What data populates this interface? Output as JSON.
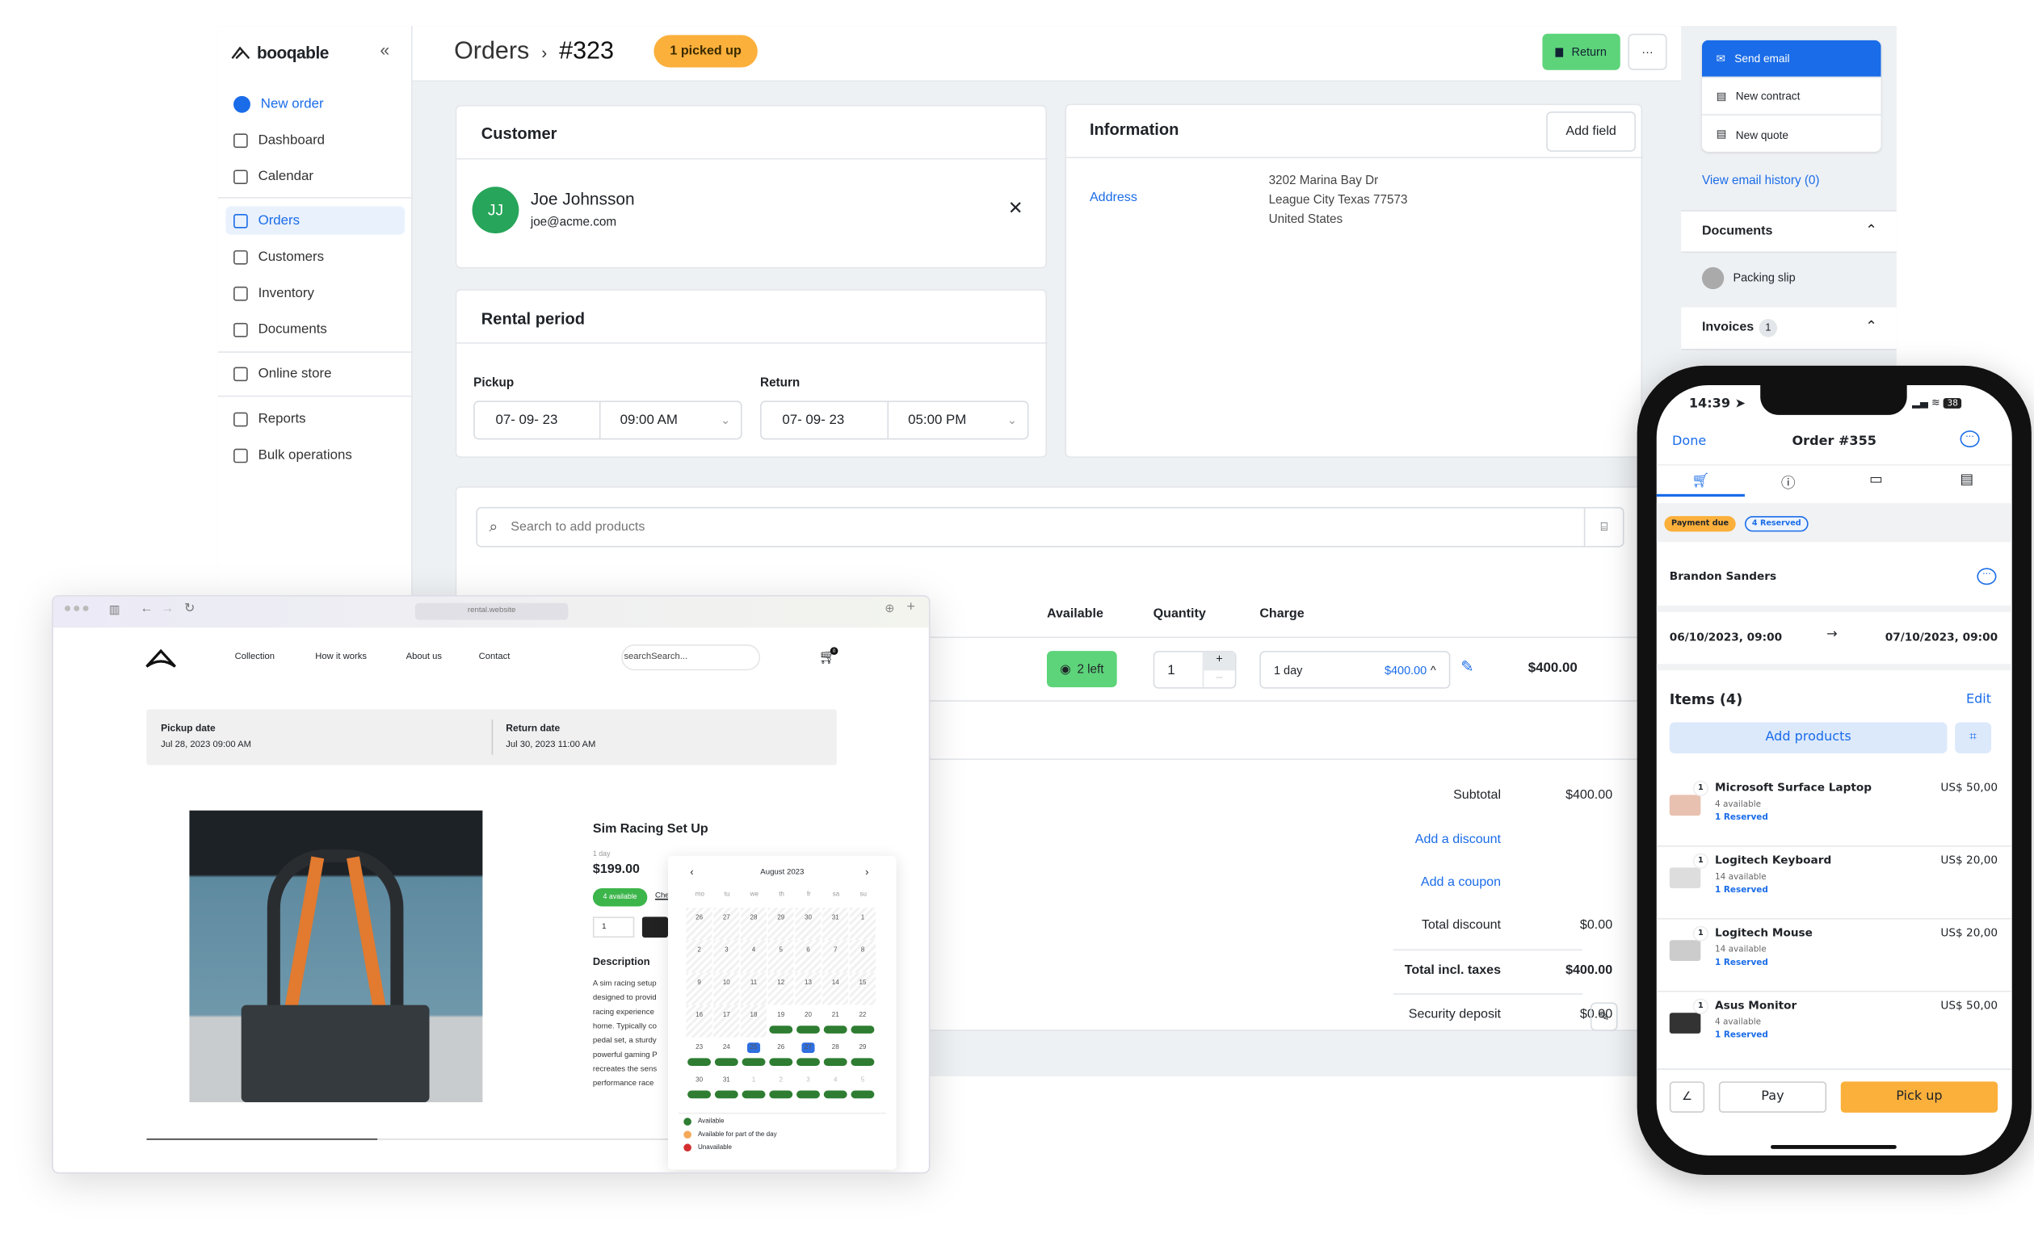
{
  "brand": {
    "name": "booqable"
  },
  "sidebar": {
    "items": [
      {
        "label": "New order",
        "icon": "plus-circle-icon"
      },
      {
        "label": "Dashboard",
        "icon": "gauge-icon"
      },
      {
        "label": "Calendar",
        "icon": "calendar-icon"
      },
      {
        "label": "Orders",
        "icon": "inbox-icon",
        "active": true
      },
      {
        "label": "Customers",
        "icon": "user-icon"
      },
      {
        "label": "Inventory",
        "icon": "box-icon"
      },
      {
        "label": "Documents",
        "icon": "document-icon"
      },
      {
        "label": "Online store",
        "icon": "store-icon"
      },
      {
        "label": "Reports",
        "icon": "chart-icon"
      },
      {
        "label": "Bulk operations",
        "icon": "stack-icon"
      }
    ]
  },
  "header": {
    "breadcrumb": "Orders",
    "separator": "›",
    "order_number": "#323",
    "status_badge": "1 picked up",
    "return_label": "Return",
    "more_label": "···"
  },
  "customer": {
    "title": "Customer",
    "initials": "JJ",
    "name": "Joe Johnsson",
    "email": "joe@acme.com"
  },
  "rental_period": {
    "title": "Rental period",
    "pickup_label": "Pickup",
    "pickup_date": "07- 09- 23",
    "pickup_time": "09:00 AM",
    "return_label": "Return",
    "return_date": "07- 09- 23",
    "return_time": "05:00 PM"
  },
  "information": {
    "title": "Information",
    "add_field": "Add field",
    "address_label": "Address",
    "address_lines": [
      "3202 Marina Bay Dr",
      "League City Texas 77573",
      "United States"
    ]
  },
  "products": {
    "search_placeholder": "Search to add products",
    "columns": [
      "Available",
      "Quantity",
      "Charge"
    ],
    "row": {
      "available": "2 left",
      "quantity": "1",
      "charge_period": "1 day",
      "charge_price": "$400.00",
      "total": "$400.00"
    },
    "totals": {
      "subtotal_label": "Subtotal",
      "subtotal": "$400.00",
      "add_discount": "Add a discount",
      "add_coupon": "Add a coupon",
      "total_discount_label": "Total discount",
      "total_discount": "$0.00",
      "total_label": "Total incl. taxes",
      "total": "$400.00",
      "deposit_label": "Security deposit",
      "deposit": "$0.00"
    }
  },
  "right_panel": {
    "actions": [
      "Send email",
      "New contract",
      "New quote"
    ],
    "email_history": "View email history (0)",
    "documents_title": "Documents",
    "packing_slip": "Packing slip",
    "invoices_title": "Invoices",
    "invoices_count": "1"
  },
  "browser": {
    "url": "rental.website",
    "nav": [
      "Collection",
      "How it works",
      "About us",
      "Contact"
    ],
    "search_placeholder": "searchSearch...",
    "cart_count": "0",
    "pickup_label": "Pickup date",
    "pickup_value": "Jul 28, 2023 09:00 AM",
    "return_label": "Return date",
    "return_value": "Jul 30, 2023 11:00 AM",
    "product_title": "Sim Racing Set Up",
    "period": "1 day",
    "price": "$199.00",
    "availability": "4 available",
    "check_link": "Che",
    "quantity": "1",
    "description_title": "Description",
    "description_lines": [
      "A sim racing setup",
      "designed to provid",
      "racing experience",
      "home. Typically co",
      "pedal set, a sturdy",
      "powerful gaming P",
      "recreates the sens",
      "performance race"
    ],
    "calendar": {
      "month": "August 2023",
      "weekdays": [
        "mo",
        "tu",
        "we",
        "th",
        "fr",
        "sa",
        "su"
      ],
      "weeks": [
        [
          {
            "d": "26"
          },
          {
            "d": "27"
          },
          {
            "d": "28"
          },
          {
            "d": "29"
          },
          {
            "d": "30"
          },
          {
            "d": "31"
          },
          {
            "d": "1"
          }
        ],
        [
          {
            "d": "2"
          },
          {
            "d": "3"
          },
          {
            "d": "4"
          },
          {
            "d": "5"
          },
          {
            "d": "6"
          },
          {
            "d": "7"
          },
          {
            "d": "8"
          }
        ],
        [
          {
            "d": "9"
          },
          {
            "d": "10"
          },
          {
            "d": "11"
          },
          {
            "d": "12"
          },
          {
            "d": "13"
          },
          {
            "d": "14"
          },
          {
            "d": "15"
          }
        ],
        [
          {
            "d": "16"
          },
          {
            "d": "17"
          },
          {
            "d": "18"
          },
          {
            "d": "19",
            "a": 1
          },
          {
            "d": "20",
            "a": 1
          },
          {
            "d": "21",
            "a": 1
          },
          {
            "d": "22",
            "a": 1
          }
        ],
        [
          {
            "d": "23",
            "a": 1
          },
          {
            "d": "24",
            "a": 1
          },
          {
            "d": "25",
            "a": 1,
            "s": 1
          },
          {
            "d": "26",
            "a": 1
          },
          {
            "d": "27",
            "a": 1,
            "s": 1
          },
          {
            "d": "28",
            "a": 1
          },
          {
            "d": "29",
            "a": 1
          }
        ],
        [
          {
            "d": "30",
            "a": 1
          },
          {
            "d": "31",
            "a": 1
          },
          {
            "d": "1",
            "a": 1,
            "o": 1
          },
          {
            "d": "2",
            "a": 1,
            "o": 1
          },
          {
            "d": "3",
            "a": 1,
            "o": 1
          },
          {
            "d": "4",
            "a": 1,
            "o": 1
          },
          {
            "d": "5",
            "a": 1,
            "o": 1
          }
        ]
      ],
      "legend": [
        {
          "label": "Available",
          "color": "#2e7d32"
        },
        {
          "label": "Available for part of the day",
          "color": "#f4a95a"
        },
        {
          "label": "Unavailable",
          "color": "#d32f2f"
        }
      ]
    }
  },
  "mobile": {
    "time": "14:39",
    "battery": "38",
    "done": "Done",
    "title": "Order #355",
    "tabs": [
      "cart-icon",
      "info-icon",
      "card-icon",
      "document-icon"
    ],
    "badge_payment": "Payment due",
    "badge_reserved": "4 Reserved",
    "customer": "Brandon Sanders",
    "start": "06/10/2023, 09:00",
    "end": "07/10/2023, 09:00",
    "items_title": "Items  (4)",
    "edit": "Edit",
    "add_products": "Add products",
    "items": [
      {
        "qty": "1",
        "name": "Microsoft Surface Laptop",
        "available": "4 available",
        "reserved": "1 Reserved",
        "price": "US$ 50,00"
      },
      {
        "qty": "1",
        "name": "Logitech Keyboard",
        "available": "14 available",
        "reserved": "1 Reserved",
        "price": "US$ 20,00"
      },
      {
        "qty": "1",
        "name": "Logitech Mouse",
        "available": "14 available",
        "reserved": "1 Reserved",
        "price": "US$ 20,00"
      },
      {
        "qty": "1",
        "name": "Asus Monitor",
        "available": "4 available",
        "reserved": "1 Reserved",
        "price": "US$ 50,00"
      }
    ],
    "pay": "Pay",
    "pick_up": "Pick up"
  },
  "colors": {
    "accent": "#1a6ce8",
    "success": "#5dd47a",
    "warning": "#fbb03b",
    "avatar": "#27a55a"
  }
}
